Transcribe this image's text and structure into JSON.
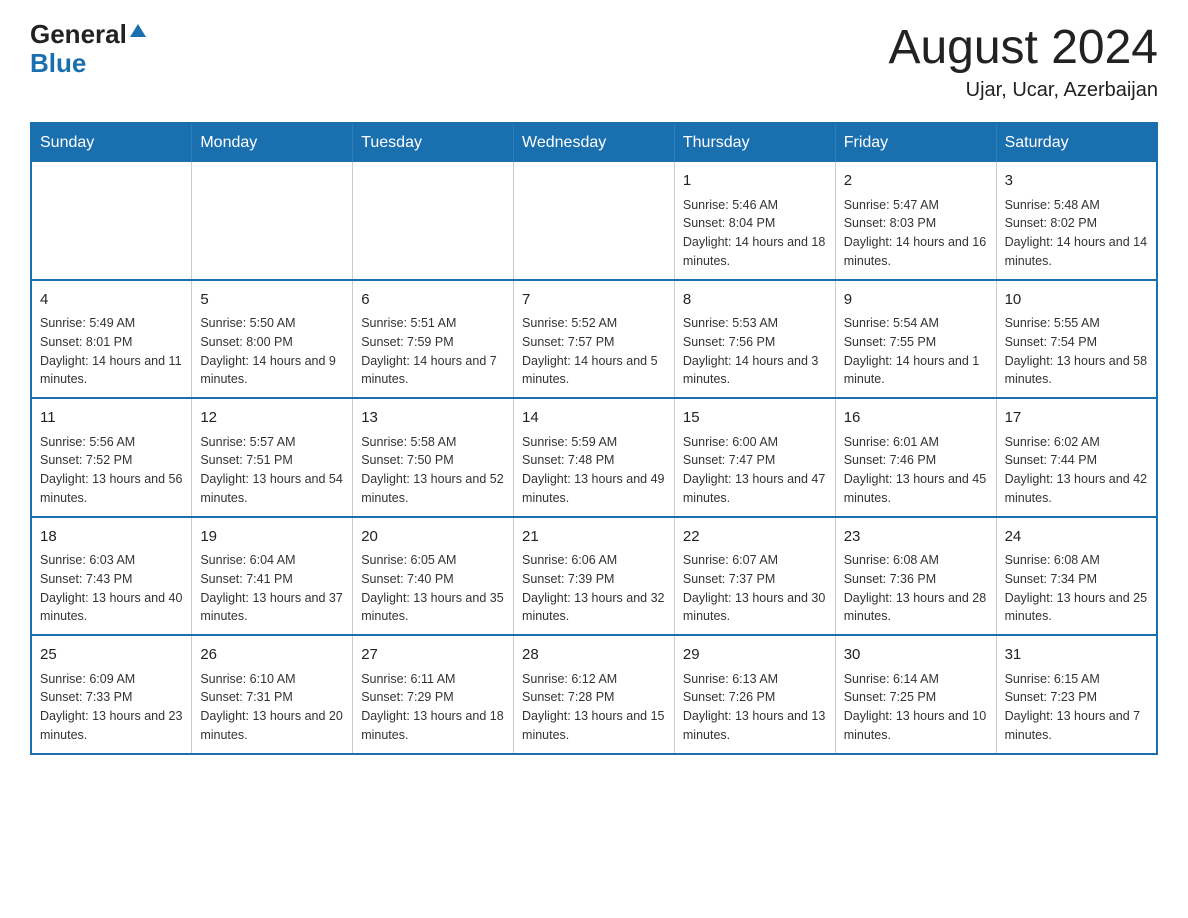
{
  "logo": {
    "general": "General",
    "blue": "Blue"
  },
  "title": "August 2024",
  "location": "Ujar, Ucar, Azerbaijan",
  "days_of_week": [
    "Sunday",
    "Monday",
    "Tuesday",
    "Wednesday",
    "Thursday",
    "Friday",
    "Saturday"
  ],
  "weeks": [
    [
      {
        "day": "",
        "info": ""
      },
      {
        "day": "",
        "info": ""
      },
      {
        "day": "",
        "info": ""
      },
      {
        "day": "",
        "info": ""
      },
      {
        "day": "1",
        "info": "Sunrise: 5:46 AM\nSunset: 8:04 PM\nDaylight: 14 hours and 18 minutes."
      },
      {
        "day": "2",
        "info": "Sunrise: 5:47 AM\nSunset: 8:03 PM\nDaylight: 14 hours and 16 minutes."
      },
      {
        "day": "3",
        "info": "Sunrise: 5:48 AM\nSunset: 8:02 PM\nDaylight: 14 hours and 14 minutes."
      }
    ],
    [
      {
        "day": "4",
        "info": "Sunrise: 5:49 AM\nSunset: 8:01 PM\nDaylight: 14 hours and 11 minutes."
      },
      {
        "day": "5",
        "info": "Sunrise: 5:50 AM\nSunset: 8:00 PM\nDaylight: 14 hours and 9 minutes."
      },
      {
        "day": "6",
        "info": "Sunrise: 5:51 AM\nSunset: 7:59 PM\nDaylight: 14 hours and 7 minutes."
      },
      {
        "day": "7",
        "info": "Sunrise: 5:52 AM\nSunset: 7:57 PM\nDaylight: 14 hours and 5 minutes."
      },
      {
        "day": "8",
        "info": "Sunrise: 5:53 AM\nSunset: 7:56 PM\nDaylight: 14 hours and 3 minutes."
      },
      {
        "day": "9",
        "info": "Sunrise: 5:54 AM\nSunset: 7:55 PM\nDaylight: 14 hours and 1 minute."
      },
      {
        "day": "10",
        "info": "Sunrise: 5:55 AM\nSunset: 7:54 PM\nDaylight: 13 hours and 58 minutes."
      }
    ],
    [
      {
        "day": "11",
        "info": "Sunrise: 5:56 AM\nSunset: 7:52 PM\nDaylight: 13 hours and 56 minutes."
      },
      {
        "day": "12",
        "info": "Sunrise: 5:57 AM\nSunset: 7:51 PM\nDaylight: 13 hours and 54 minutes."
      },
      {
        "day": "13",
        "info": "Sunrise: 5:58 AM\nSunset: 7:50 PM\nDaylight: 13 hours and 52 minutes."
      },
      {
        "day": "14",
        "info": "Sunrise: 5:59 AM\nSunset: 7:48 PM\nDaylight: 13 hours and 49 minutes."
      },
      {
        "day": "15",
        "info": "Sunrise: 6:00 AM\nSunset: 7:47 PM\nDaylight: 13 hours and 47 minutes."
      },
      {
        "day": "16",
        "info": "Sunrise: 6:01 AM\nSunset: 7:46 PM\nDaylight: 13 hours and 45 minutes."
      },
      {
        "day": "17",
        "info": "Sunrise: 6:02 AM\nSunset: 7:44 PM\nDaylight: 13 hours and 42 minutes."
      }
    ],
    [
      {
        "day": "18",
        "info": "Sunrise: 6:03 AM\nSunset: 7:43 PM\nDaylight: 13 hours and 40 minutes."
      },
      {
        "day": "19",
        "info": "Sunrise: 6:04 AM\nSunset: 7:41 PM\nDaylight: 13 hours and 37 minutes."
      },
      {
        "day": "20",
        "info": "Sunrise: 6:05 AM\nSunset: 7:40 PM\nDaylight: 13 hours and 35 minutes."
      },
      {
        "day": "21",
        "info": "Sunrise: 6:06 AM\nSunset: 7:39 PM\nDaylight: 13 hours and 32 minutes."
      },
      {
        "day": "22",
        "info": "Sunrise: 6:07 AM\nSunset: 7:37 PM\nDaylight: 13 hours and 30 minutes."
      },
      {
        "day": "23",
        "info": "Sunrise: 6:08 AM\nSunset: 7:36 PM\nDaylight: 13 hours and 28 minutes."
      },
      {
        "day": "24",
        "info": "Sunrise: 6:08 AM\nSunset: 7:34 PM\nDaylight: 13 hours and 25 minutes."
      }
    ],
    [
      {
        "day": "25",
        "info": "Sunrise: 6:09 AM\nSunset: 7:33 PM\nDaylight: 13 hours and 23 minutes."
      },
      {
        "day": "26",
        "info": "Sunrise: 6:10 AM\nSunset: 7:31 PM\nDaylight: 13 hours and 20 minutes."
      },
      {
        "day": "27",
        "info": "Sunrise: 6:11 AM\nSunset: 7:29 PM\nDaylight: 13 hours and 18 minutes."
      },
      {
        "day": "28",
        "info": "Sunrise: 6:12 AM\nSunset: 7:28 PM\nDaylight: 13 hours and 15 minutes."
      },
      {
        "day": "29",
        "info": "Sunrise: 6:13 AM\nSunset: 7:26 PM\nDaylight: 13 hours and 13 minutes."
      },
      {
        "day": "30",
        "info": "Sunrise: 6:14 AM\nSunset: 7:25 PM\nDaylight: 13 hours and 10 minutes."
      },
      {
        "day": "31",
        "info": "Sunrise: 6:15 AM\nSunset: 7:23 PM\nDaylight: 13 hours and 7 minutes."
      }
    ]
  ]
}
